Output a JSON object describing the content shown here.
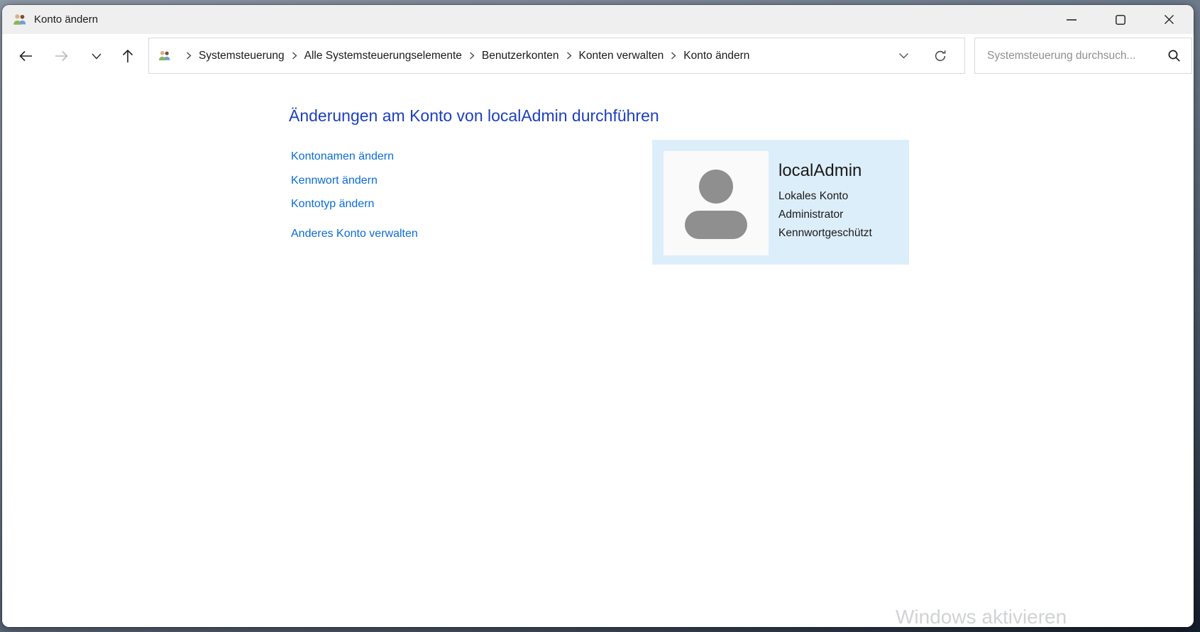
{
  "window": {
    "title": "Konto ändern"
  },
  "toolbar": {
    "breadcrumb": {
      "items": [
        "Systemsteuerung",
        "Alle Systemsteuerungselemente",
        "Benutzerkonten",
        "Konten verwalten",
        "Konto ändern"
      ]
    },
    "search": {
      "placeholder": "Systemsteuerung durchsuch..."
    }
  },
  "main": {
    "heading": "Änderungen am Konto von localAdmin durchführen",
    "links": [
      "Kontonamen ändern",
      "Kennwort ändern",
      "Kontotyp ändern",
      "Anderes Konto verwalten"
    ],
    "account_card": {
      "name": "localAdmin",
      "details": [
        "Lokales Konto",
        "Administrator",
        "Kennwortgeschützt"
      ]
    }
  },
  "watermark": "Windows aktivieren",
  "icons": {
    "titlebar_app": "user-accounts-people",
    "breadcrumb_root": "user-accounts-people",
    "nav_buttons": [
      "back-arrow",
      "forward-arrow",
      "chevron-down",
      "up-arrow"
    ],
    "address_right": [
      "chevron-down",
      "refresh"
    ],
    "search": "magnifier",
    "window_controls": [
      "minimize",
      "maximize",
      "close"
    ],
    "avatar": "person-silhouette"
  },
  "colors": {
    "heading_blue": "#1d3fbf",
    "link_blue": "#0b6cd8",
    "card_background": "#ddeefb",
    "titlebar_background": "#efefef",
    "avatar_gray": "#8f8f8f",
    "watermark_gray": "#d0d2d4"
  }
}
